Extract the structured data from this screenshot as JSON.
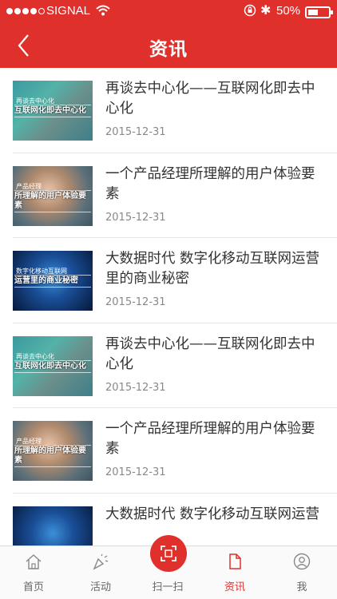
{
  "status": {
    "carrier": "SIGNAL",
    "battery_pct": "50%",
    "battery_level": 0.5
  },
  "header": {
    "title": "资讯"
  },
  "articles": [
    {
      "title": "再谈去中心化——互联网化即去中心化",
      "date": "2015-12-31",
      "thumb_caption": "互联网化即去中心化",
      "thumb_sub": "再谈去中心化",
      "thumb_style": "t1"
    },
    {
      "title": "一个产品经理所理解的用户体验要素",
      "date": "2015-12-31",
      "thumb_caption": "所理解的用户体验要素",
      "thumb_sub": "产品经理",
      "thumb_style": "t2"
    },
    {
      "title": "大数据时代 数字化移动互联网运营里的商业秘密",
      "date": "2015-12-31",
      "thumb_caption": "运营里的商业秘密",
      "thumb_sub": "数字化移动互联网",
      "thumb_style": "t3"
    },
    {
      "title": "再谈去中心化——互联网化即去中心化",
      "date": "2015-12-31",
      "thumb_caption": "互联网化即去中心化",
      "thumb_sub": "再谈去中心化",
      "thumb_style": "t1"
    },
    {
      "title": "一个产品经理所理解的用户体验要素",
      "date": "2015-12-31",
      "thumb_caption": "所理解的用户体验要素",
      "thumb_sub": "产品经理",
      "thumb_style": "t2"
    },
    {
      "title": "大数据时代 数字化移动互联网运营",
      "date": "",
      "thumb_caption": "",
      "thumb_sub": "",
      "thumb_style": "t3"
    }
  ],
  "tabs": [
    {
      "label": "首页",
      "icon": "home-icon"
    },
    {
      "label": "活动",
      "icon": "party-icon"
    },
    {
      "label": "扫一扫",
      "icon": "scan-icon"
    },
    {
      "label": "资讯",
      "icon": "document-icon",
      "active": true
    },
    {
      "label": "我",
      "icon": "profile-icon"
    }
  ],
  "colors": {
    "brand": "#e0302c",
    "text": "#333333",
    "muted": "#888888"
  }
}
